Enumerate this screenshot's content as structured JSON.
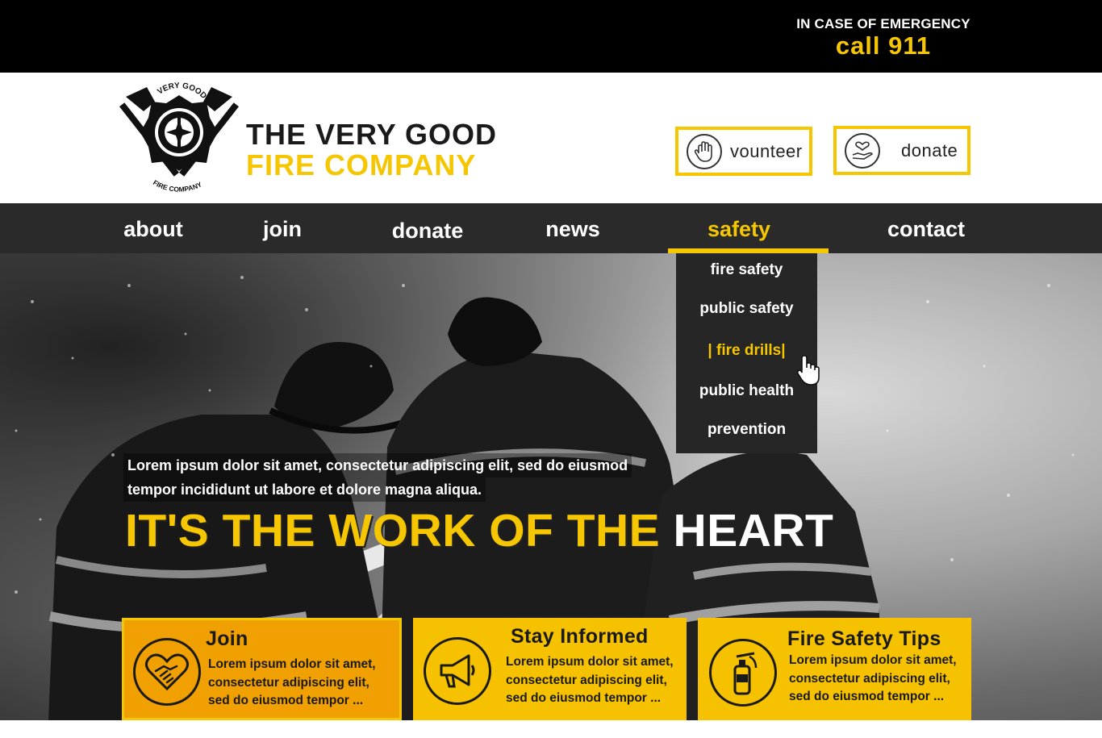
{
  "emergency": {
    "line": "IN CASE OF EMERGENCY",
    "call": "call 911"
  },
  "brand": {
    "line1": "THE VERY GOOD",
    "line2": "FIRE COMPANY"
  },
  "logo": {
    "top_text": "VERY GOOD",
    "bottom_text": "FIRE COMPANY"
  },
  "header_buttons": [
    {
      "label": "vounteer",
      "icon": "hand-icon"
    },
    {
      "label": "donate",
      "icon": "heart-hand-icon"
    }
  ],
  "nav": {
    "items": [
      {
        "label": "about"
      },
      {
        "label": "join"
      },
      {
        "label": "donate"
      },
      {
        "label": "news"
      },
      {
        "label": "safety",
        "active": true
      },
      {
        "label": "contact"
      }
    ]
  },
  "dropdown": {
    "items": [
      {
        "label": "fire safety"
      },
      {
        "label": "public safety"
      },
      {
        "label": "| fire drills|",
        "active": true
      },
      {
        "label": "public health"
      },
      {
        "label": "prevention"
      }
    ]
  },
  "hero": {
    "lorem_line1": "Lorem ipsum dolor sit amet, consectetur adipiscing elit, sed do eiusmod",
    "lorem_line2": "tempor incididunt ut labore et dolore magna aliqua.",
    "headline_yellow": "IT'S THE WORK OF THE",
    "headline_white": "HEART"
  },
  "cards": [
    {
      "title": "Join",
      "line1": "Lorem ipsum dolor sit amet,",
      "line2": "consectetur adipiscing elit,",
      "line3": "sed do eiusmod tempor ...",
      "icon": "heart-handshake-icon"
    },
    {
      "title": "Stay Informed",
      "line1": "Lorem ipsum dolor sit amet,",
      "line2": "consectetur adipiscing elit,",
      "line3": "sed do eiusmod tempor ...",
      "icon": "megaphone-icon"
    },
    {
      "title": "Fire Safety Tips",
      "line1": "Lorem ipsum dolor sit amet,",
      "line2": "consectetur adipiscing elit,",
      "line3": "sed do eiusmod tempor ...",
      "icon": "fire-extinguisher-icon"
    }
  ],
  "colors": {
    "accent": "#f6c600",
    "dark": "#2a2a2a",
    "card_active": "#f0a000"
  }
}
